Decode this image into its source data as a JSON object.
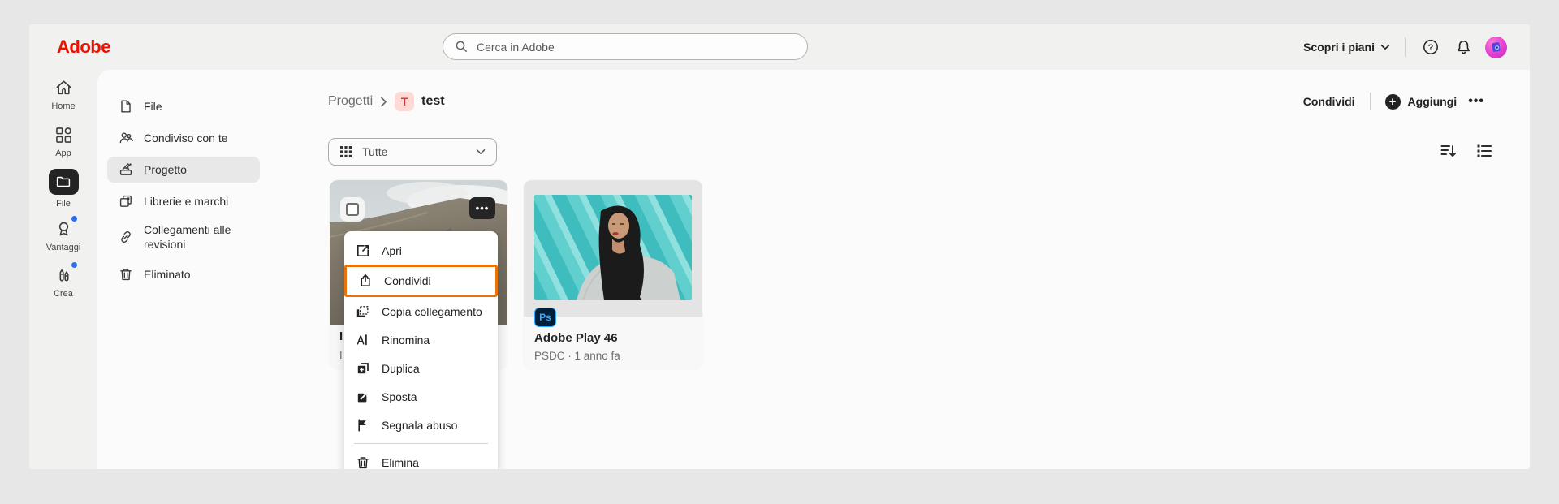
{
  "header": {
    "logo": "Adobe",
    "search_placeholder": "Cerca in Adobe",
    "plans": "Scopri i piani"
  },
  "rail": {
    "items": [
      {
        "label": "Home",
        "icon": "home-icon",
        "active": false,
        "dot": false
      },
      {
        "label": "App",
        "icon": "apps-icon",
        "active": false,
        "dot": false
      },
      {
        "label": "File",
        "icon": "folder-icon",
        "active": true,
        "dot": false
      },
      {
        "label": "Vantaggi",
        "icon": "award-icon",
        "active": false,
        "dot": true
      },
      {
        "label": "Crea",
        "icon": "crayons-icon",
        "active": false,
        "dot": true
      }
    ]
  },
  "sidebar": {
    "items": [
      {
        "label": "File",
        "icon": "document-icon",
        "active": false
      },
      {
        "label": "Condiviso con te",
        "icon": "people-icon",
        "active": false
      },
      {
        "label": "Progetto",
        "icon": "project-icon",
        "active": true
      },
      {
        "label": "Librerie e marchi",
        "icon": "libraries-icon",
        "active": false
      },
      {
        "label": "Collegamenti alle revisioni",
        "icon": "link-icon",
        "active": false
      },
      {
        "label": "Eliminato",
        "icon": "trash-icon",
        "active": false
      }
    ]
  },
  "breadcrumb": {
    "parent": "Progetti",
    "badge": "T",
    "current": "test"
  },
  "toolbar": {
    "share": "Condividi",
    "add": "Aggiungi",
    "more": "•••"
  },
  "filter": {
    "selected": "Tutte"
  },
  "context_menu": {
    "highlighted": "Condividi",
    "items": [
      {
        "label": "Apri",
        "icon": "open-icon"
      },
      {
        "label": "Condividi",
        "icon": "share-icon"
      },
      {
        "label": "Copia collegamento",
        "icon": "copy-link-icon"
      },
      {
        "label": "Rinomina",
        "icon": "rename-icon"
      },
      {
        "label": "Duplica",
        "icon": "duplicate-icon"
      },
      {
        "label": "Sposta",
        "icon": "move-icon"
      },
      {
        "label": "Segnala abuso",
        "icon": "report-flag-icon"
      },
      {
        "label": "Elimina",
        "icon": "delete-icon"
      }
    ]
  },
  "cards": {
    "card1": {
      "title_fragment": "I",
      "subtitle_fragment": "I",
      "more": "•••"
    },
    "card2": {
      "badge": "Ps",
      "title": "Adobe Play 46",
      "meta": "PSDC · 1 anno fa"
    }
  },
  "colors": {
    "adobe_red": "#EB1000",
    "highlight_orange": "#E8730C",
    "notification_blue": "#2E6FF2",
    "ps_badge_bg": "#001E36",
    "ps_badge_text": "#31A8FF",
    "breadcrumb_badge_bg": "#FFD9D4",
    "breadcrumb_badge_text": "#D7373F"
  }
}
